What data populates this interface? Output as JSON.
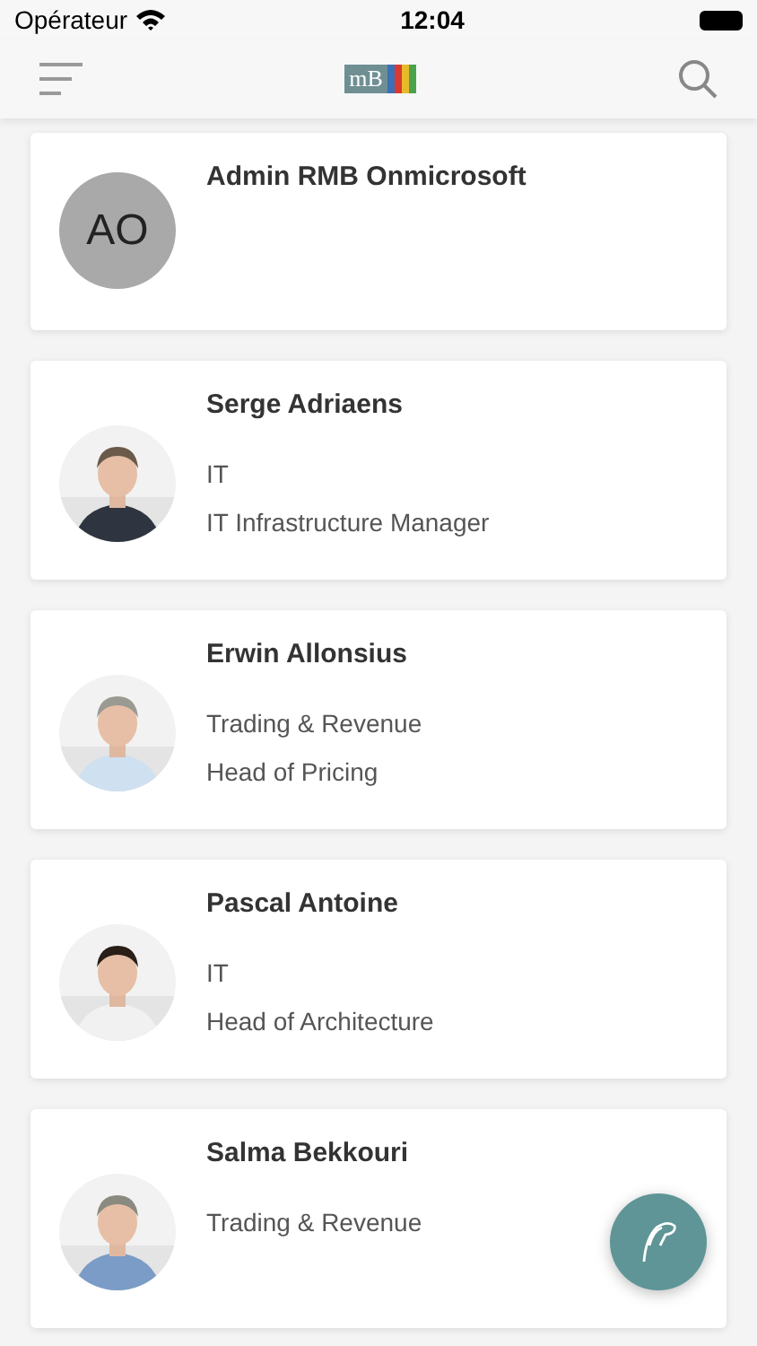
{
  "status_bar": {
    "carrier": "Opérateur",
    "time": "12:04"
  },
  "nav_bar": {
    "logo_text": "mB"
  },
  "people": [
    {
      "name": "Admin RMB Onmicrosoft",
      "avatar": {
        "kind": "initials",
        "initials": "AO"
      }
    },
    {
      "name": "Serge Adriaens",
      "department": "IT",
      "title": "IT Infrastructure Manager"
    },
    {
      "name": "Erwin Allonsius",
      "department": "Trading & Revenue",
      "title": "Head of Pricing"
    },
    {
      "name": "Pascal Antoine",
      "department": "IT",
      "title": "Head of Architecture"
    },
    {
      "name": "Salma Bekkouri",
      "department": "Trading & Revenue"
    }
  ]
}
